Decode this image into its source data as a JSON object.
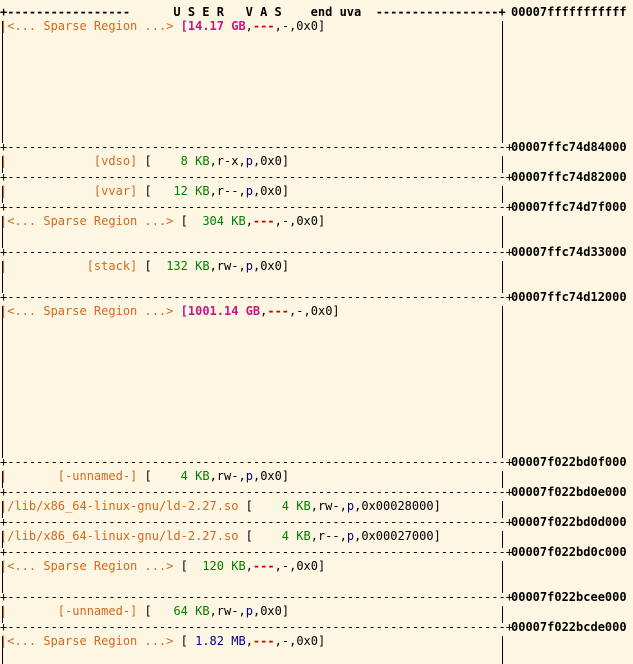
{
  "header": {
    "title": "U S E R   V A S",
    "end_label": "end uva"
  },
  "addresses": [
    "00007fffffffffff",
    "00007ffc74d84000",
    "00007ffc74d82000",
    "00007ffc74d7f000",
    "00007ffc74d33000",
    "00007ffc74d12000",
    "00007f022bd0f000",
    "00007f022bd0e000",
    "00007f022bd0d000",
    "00007f022bd0c000",
    "00007f022bcee000",
    "00007f022bcde000"
  ],
  "regions": [
    {
      "name": "<... Sparse Region ...>",
      "size": "14.17",
      "unit": "GB",
      "perms": "---",
      "flag": "-",
      "offset": "0x0"
    },
    {
      "name": "[vdso]",
      "size": "8",
      "unit": "KB",
      "perms": "r-x",
      "flag": "p",
      "offset": "0x0"
    },
    {
      "name": "[vvar]",
      "size": "12",
      "unit": "KB",
      "perms": "r--",
      "flag": "p",
      "offset": "0x0"
    },
    {
      "name": "<... Sparse Region ...>",
      "size": "304",
      "unit": "KB",
      "perms": "---",
      "flag": "-",
      "offset": "0x0"
    },
    {
      "name": "[stack]",
      "size": "132",
      "unit": "KB",
      "perms": "rw-",
      "flag": "p",
      "offset": "0x0"
    },
    {
      "name": "<... Sparse Region ...>",
      "size": "1001.14",
      "unit": "GB",
      "perms": "---",
      "flag": "-",
      "offset": "0x0"
    },
    {
      "name": "[-unnamed-]",
      "size": "4",
      "unit": "KB",
      "perms": "rw-",
      "flag": "p",
      "offset": "0x0"
    },
    {
      "name": "/lib/x86_64-linux-gnu/ld-2.27.so",
      "size": "4",
      "unit": "KB",
      "perms": "rw-",
      "flag": "p",
      "offset": "0x00028000"
    },
    {
      "name": "/lib/x86_64-linux-gnu/ld-2.27.so",
      "size": "4",
      "unit": "KB",
      "perms": "r--",
      "flag": "p",
      "offset": "0x00027000"
    },
    {
      "name": "<... Sparse Region ...>",
      "size": "120",
      "unit": "KB",
      "perms": "---",
      "flag": "-",
      "offset": "0x0"
    },
    {
      "name": "[-unnamed-]",
      "size": "64",
      "unit": "KB",
      "perms": "rw-",
      "flag": "p",
      "offset": "0x0"
    },
    {
      "name": "<... Sparse Region ...>",
      "size": "1.82",
      "unit": "MB",
      "perms": "---",
      "flag": "-",
      "offset": "0x0"
    }
  ],
  "colors": {
    "background": "#fdf6e3",
    "name": "#d2691e",
    "size_kb": "#008000",
    "size_gb": "#c71585",
    "size_mb": "#000080",
    "flag": "#000080",
    "perm_none": "#cc0000"
  }
}
